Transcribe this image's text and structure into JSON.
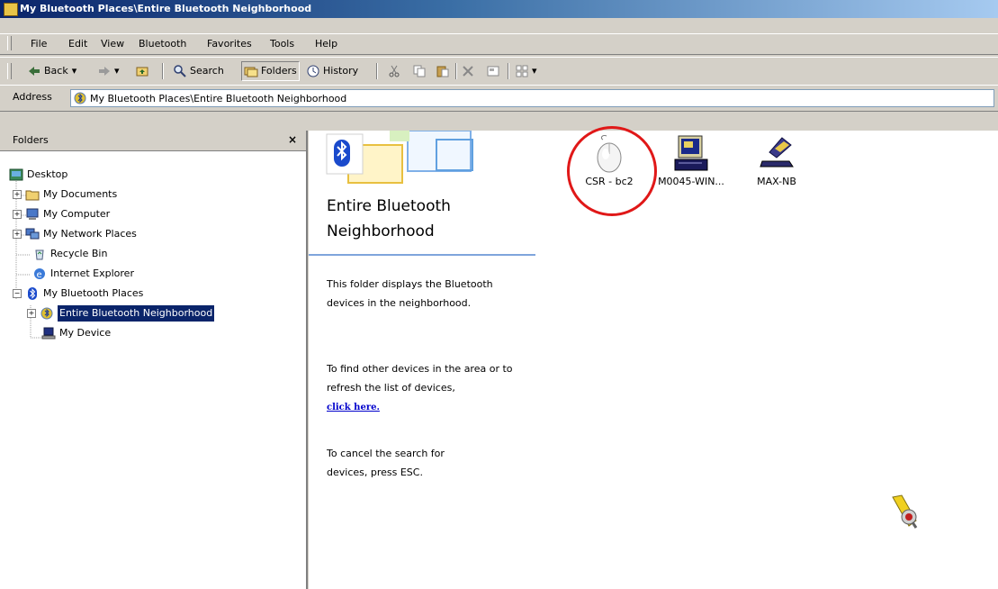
{
  "window": {
    "title": "My Bluetooth Places\\Entire Bluetooth Neighborhood"
  },
  "menu": [
    "File",
    "Edit",
    "View",
    "Bluetooth",
    "Favorites",
    "Tools",
    "Help"
  ],
  "toolbar": {
    "back": "Back",
    "search": "Search",
    "folders": "Folders",
    "history": "History"
  },
  "address": {
    "label": "Address",
    "value": "My Bluetooth Places\\Entire Bluetooth Neighborhood"
  },
  "folders_pane": {
    "title": "Folders",
    "close": "×",
    "items": [
      {
        "label": "Desktop",
        "icon": "desktop-icon"
      },
      {
        "label": "My Documents",
        "icon": "folder-icon"
      },
      {
        "label": "My Computer",
        "icon": "computer-icon"
      },
      {
        "label": "My Network Places",
        "icon": "network-icon"
      },
      {
        "label": "Recycle Bin",
        "icon": "recycle-bin-icon"
      },
      {
        "label": "Internet Explorer",
        "icon": "ie-icon"
      },
      {
        "label": "My Bluetooth Places",
        "icon": "bluetooth-icon"
      },
      {
        "label": "Entire Bluetooth Neighborhood",
        "icon": "bluetooth-globe-icon"
      },
      {
        "label": "My Device",
        "icon": "laptop-icon"
      }
    ]
  },
  "info_panel": {
    "title_line1": "Entire Bluetooth",
    "title_line2": "Neighborhood",
    "para1": "This folder displays the Bluetooth devices in the neighborhood.",
    "para2": "To find other devices in the area or to refresh the list of devices,",
    "link": "click here.",
    "para3": "To cancel the search for devices, press ESC."
  },
  "devices": [
    {
      "label": "CSR - bc2",
      "icon": "mouse-icon"
    },
    {
      "label": "M0045-WIN...",
      "icon": "computer-icon"
    },
    {
      "label": "MAX-NB",
      "icon": "notebook-icon"
    }
  ],
  "colors": {
    "title_gradient_start": "#0a246a",
    "selection": "#0a246a",
    "highlight_circle": "#e01818",
    "link": "#0000cc"
  }
}
